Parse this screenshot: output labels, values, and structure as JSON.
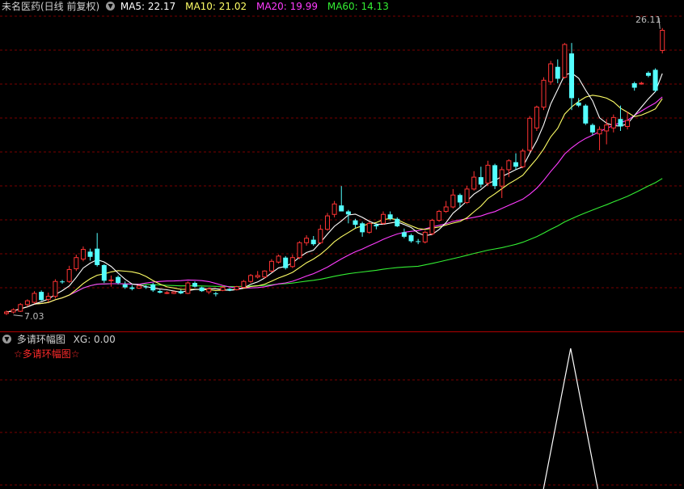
{
  "main_panel": {
    "stock_name": "未名医药(日线 前复权)",
    "indicators": [
      {
        "label": "MA5: 22.17",
        "color": "#ffffff"
      },
      {
        "label": "MA10: 21.02",
        "color": "#ffff66"
      },
      {
        "label": "MA20: 19.99",
        "color": "#ff3cff"
      },
      {
        "label": "MA60: 14.13",
        "color": "#33ee33"
      }
    ],
    "high_marker": "26.11",
    "low_marker": "7.03"
  },
  "sub_panel": {
    "name": "多请环幅图",
    "xg_label": "XG: 0.00",
    "caption": "☆多请环幅图☆"
  },
  "colors": {
    "up": "#ff3333",
    "down": "#54ffff",
    "ma5": "#ffffff",
    "ma10": "#ffff66",
    "ma20": "#ff3cff",
    "ma60": "#33ee33",
    "grid": "#7a0000",
    "signal": "#ffffff"
  },
  "chart_data": {
    "type": "candlestick",
    "ylim": [
      6.5,
      27.0
    ],
    "grid": "dashed horizontal",
    "candles": [
      [
        7.05,
        7.25,
        6.95,
        7.15
      ],
      [
        7.15,
        7.4,
        7.05,
        7.3
      ],
      [
        7.2,
        7.75,
        7.15,
        7.65
      ],
      [
        7.65,
        8.0,
        7.5,
        7.9
      ],
      [
        7.8,
        8.55,
        7.7,
        8.4
      ],
      [
        8.5,
        8.6,
        7.9,
        7.95
      ],
      [
        8.0,
        8.45,
        7.8,
        8.2
      ],
      [
        8.2,
        9.35,
        8.05,
        9.2
      ],
      [
        9.2,
        9.3,
        9.05,
        9.15
      ],
      [
        9.2,
        10.25,
        9.1,
        10.0
      ],
      [
        10.05,
        11.0,
        9.9,
        10.8
      ],
      [
        10.7,
        11.55,
        10.55,
        11.35
      ],
      [
        11.2,
        11.4,
        10.6,
        10.85
      ],
      [
        11.4,
        12.45,
        10.2,
        10.3
      ],
      [
        10.3,
        10.35,
        9.1,
        9.25
      ],
      [
        9.25,
        9.6,
        8.85,
        9.3
      ],
      [
        9.5,
        9.6,
        9.0,
        9.1
      ],
      [
        9.0,
        9.2,
        8.7,
        8.8
      ],
      [
        8.8,
        8.95,
        8.6,
        8.7
      ],
      [
        8.75,
        9.0,
        8.7,
        8.9
      ],
      [
        8.85,
        8.95,
        8.7,
        8.8
      ],
      [
        9.0,
        9.1,
        8.5,
        8.6
      ],
      [
        8.55,
        8.65,
        8.4,
        8.45
      ],
      [
        8.45,
        8.55,
        8.35,
        8.45
      ],
      [
        8.4,
        8.55,
        8.35,
        8.5
      ],
      [
        8.55,
        8.65,
        8.35,
        8.4
      ],
      [
        8.4,
        9.2,
        8.35,
        9.1
      ],
      [
        9.1,
        9.2,
        8.8,
        8.85
      ],
      [
        8.8,
        8.85,
        8.5,
        8.55
      ],
      [
        8.5,
        8.8,
        8.35,
        8.7
      ],
      [
        8.4,
        8.5,
        8.2,
        8.35
      ],
      [
        8.6,
        8.9,
        8.55,
        8.8
      ],
      [
        8.7,
        8.75,
        8.55,
        8.6
      ],
      [
        8.65,
        8.9,
        8.6,
        8.85
      ],
      [
        8.8,
        9.3,
        8.75,
        9.2
      ],
      [
        9.2,
        9.7,
        9.1,
        9.6
      ],
      [
        9.5,
        9.9,
        9.4,
        9.6
      ],
      [
        9.5,
        9.95,
        9.4,
        9.9
      ],
      [
        9.9,
        10.7,
        9.8,
        10.55
      ],
      [
        10.5,
        11.0,
        10.4,
        10.9
      ],
      [
        10.8,
        10.9,
        10.0,
        10.1
      ],
      [
        10.2,
        11.0,
        10.1,
        10.8
      ],
      [
        10.8,
        11.9,
        10.7,
        11.8
      ],
      [
        11.8,
        12.3,
        11.6,
        12.1
      ],
      [
        12.0,
        12.25,
        11.6,
        11.7
      ],
      [
        11.8,
        13.0,
        11.7,
        12.7
      ],
      [
        12.7,
        13.8,
        12.6,
        13.6
      ],
      [
        13.7,
        14.6,
        13.5,
        14.4
      ],
      [
        14.3,
        15.6,
        14.2,
        13.9
      ],
      [
        13.9,
        14.0,
        13.1,
        13.7
      ],
      [
        13.3,
        13.4,
        12.8,
        13.0
      ],
      [
        13.1,
        13.2,
        12.2,
        12.5
      ],
      [
        12.5,
        13.2,
        12.4,
        13.1
      ],
      [
        13.0,
        13.1,
        12.7,
        12.9
      ],
      [
        13.1,
        13.9,
        13.0,
        13.7
      ],
      [
        13.7,
        13.9,
        13.3,
        13.4
      ],
      [
        13.4,
        13.5,
        12.85,
        12.9
      ],
      [
        12.5,
        12.75,
        12.1,
        12.2
      ],
      [
        12.3,
        12.4,
        11.8,
        11.9
      ],
      [
        11.9,
        12.05,
        11.7,
        11.85
      ],
      [
        11.85,
        12.6,
        11.75,
        12.5
      ],
      [
        12.4,
        13.4,
        12.3,
        13.3
      ],
      [
        13.3,
        14.0,
        13.2,
        13.9
      ],
      [
        13.9,
        14.6,
        13.8,
        14.2
      ],
      [
        14.2,
        15.4,
        14.1,
        15.0
      ],
      [
        15.0,
        15.1,
        14.2,
        14.5
      ],
      [
        14.5,
        15.6,
        14.4,
        15.4
      ],
      [
        15.4,
        16.6,
        15.3,
        16.2
      ],
      [
        16.2,
        16.9,
        15.5,
        15.7
      ],
      [
        15.8,
        17.3,
        15.6,
        17.0
      ],
      [
        17.0,
        17.1,
        15.4,
        15.6
      ],
      [
        15.6,
        16.9,
        14.8,
        16.7
      ],
      [
        16.7,
        17.4,
        16.2,
        17.3
      ],
      [
        17.2,
        17.8,
        16.7,
        16.9
      ],
      [
        16.9,
        18.1,
        16.8,
        17.95
      ],
      [
        18.0,
        20.3,
        17.9,
        20.15
      ],
      [
        19.5,
        21.0,
        19.3,
        20.9
      ],
      [
        20.9,
        22.9,
        20.7,
        22.7
      ],
      [
        22.6,
        24.0,
        22.4,
        23.8
      ],
      [
        23.6,
        24.1,
        22.5,
        22.8
      ],
      [
        22.9,
        25.2,
        22.8,
        25.1
      ],
      [
        24.5,
        25.2,
        20.7,
        21.5
      ],
      [
        21.2,
        21.5,
        20.9,
        21.0
      ],
      [
        21.0,
        21.1,
        19.7,
        19.8
      ],
      [
        19.7,
        19.8,
        19.0,
        19.2
      ],
      [
        19.1,
        19.6,
        18.0,
        19.4
      ],
      [
        19.3,
        20.1,
        18.4,
        19.7
      ],
      [
        19.5,
        20.4,
        19.2,
        20.2
      ],
      [
        20.1,
        21.0,
        19.3,
        19.6
      ],
      [
        19.6,
        20.6,
        19.4,
        20.0
      ],
      [
        22.5,
        22.6,
        22.0,
        22.2
      ],
      [
        22.45,
        22.6,
        22.4,
        22.5
      ],
      [
        23.2,
        23.3,
        22.9,
        23.0
      ],
      [
        23.4,
        23.5,
        21.9,
        22.0
      ],
      [
        24.7,
        26.2,
        24.5,
        26.05
      ]
    ],
    "signal": {
      "baseline_index_range": [
        0,
        94
      ],
      "spikes": [
        {
          "rise_start": 40,
          "peak_start": 42,
          "peak_end": 42,
          "fall_end": 44
        },
        {
          "rise_start": 90,
          "peak_start": 92,
          "peak_end": 99,
          "fall_end": 101
        }
      ],
      "x_scale_points": 146
    }
  }
}
